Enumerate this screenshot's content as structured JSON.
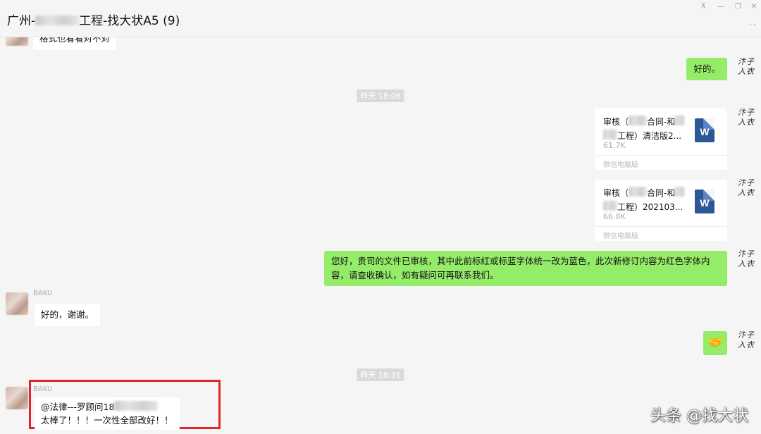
{
  "window": {
    "title_prefix": "广州-",
    "title_suffix": "工程-找大状A5 (9)",
    "pin_icon": "pin-icon",
    "minimize_glyph": "—",
    "maximize_glyph": "❐",
    "close_glyph": "✕",
    "more_glyph": "··"
  },
  "messages": {
    "top_partial": "格式也看看对不对",
    "ok_reply": "好的。",
    "timestamp1": "昨天 18:06",
    "file1": {
      "name_a": "审核（",
      "name_b": "合同-和",
      "name_c": "工程）清洁版2...",
      "size": "61.7K",
      "source": "微信电脑版",
      "icon": "W"
    },
    "file2": {
      "name_a": "审核（",
      "name_b": "合同-和",
      "name_c": "工程）202103...",
      "size": "66.8K",
      "source": "微信电脑版",
      "icon": "W"
    },
    "long_reply": "您好，贵司的文件已审核，其中此前标红或标蓝字体统一改为蓝色，此次新修订内容为红色字体内容，请查收确认，如有疑问可再联系我们。",
    "baku_name1": "BAKU",
    "baku_reply1": "好的，谢谢。",
    "handshake": "🤝",
    "timestamp2": "昨天 18:31",
    "baku_name2": "BAKU",
    "baku_line1": "@法律---罗顾问18",
    "baku_line2": "太棒了！！！一次性全部改好！！"
  },
  "me_avatar_text": "汴子\n入衣",
  "watermark": "头条 @找大状"
}
